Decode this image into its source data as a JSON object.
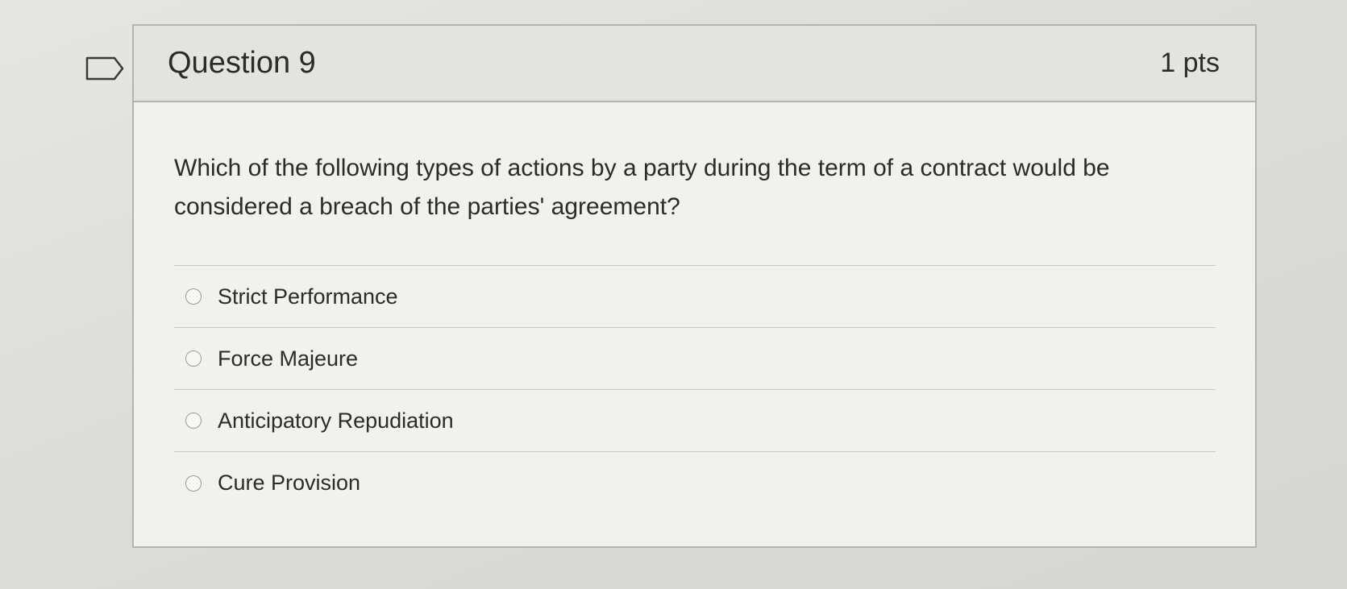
{
  "question": {
    "title": "Question 9",
    "points": "1 pts",
    "text": "Which of the following types of actions by a party during the term of a contract would be considered a breach of the parties' agreement?"
  },
  "answers": [
    {
      "label": "Strict Performance"
    },
    {
      "label": "Force Majeure"
    },
    {
      "label": "Anticipatory Repudiation"
    },
    {
      "label": "Cure Provision"
    }
  ],
  "icons": {
    "flag": "flag-outline-icon",
    "radio": "radio-unchecked-icon"
  }
}
